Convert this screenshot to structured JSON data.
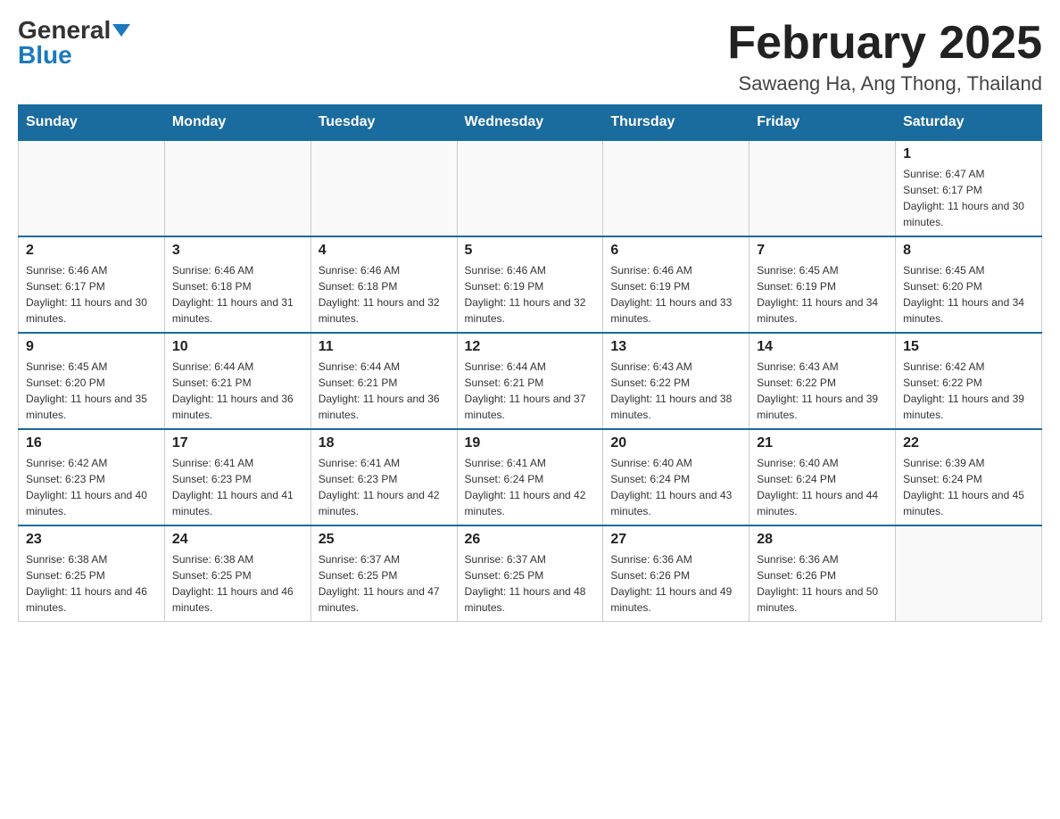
{
  "logo": {
    "general": "General",
    "blue": "Blue"
  },
  "title": {
    "month": "February 2025",
    "location": "Sawaeng Ha, Ang Thong, Thailand"
  },
  "days_of_week": [
    "Sunday",
    "Monday",
    "Tuesday",
    "Wednesday",
    "Thursday",
    "Friday",
    "Saturday"
  ],
  "weeks": [
    [
      {
        "day": "",
        "info": ""
      },
      {
        "day": "",
        "info": ""
      },
      {
        "day": "",
        "info": ""
      },
      {
        "day": "",
        "info": ""
      },
      {
        "day": "",
        "info": ""
      },
      {
        "day": "",
        "info": ""
      },
      {
        "day": "1",
        "info": "Sunrise: 6:47 AM\nSunset: 6:17 PM\nDaylight: 11 hours and 30 minutes."
      }
    ],
    [
      {
        "day": "2",
        "info": "Sunrise: 6:46 AM\nSunset: 6:17 PM\nDaylight: 11 hours and 30 minutes."
      },
      {
        "day": "3",
        "info": "Sunrise: 6:46 AM\nSunset: 6:18 PM\nDaylight: 11 hours and 31 minutes."
      },
      {
        "day": "4",
        "info": "Sunrise: 6:46 AM\nSunset: 6:18 PM\nDaylight: 11 hours and 32 minutes."
      },
      {
        "day": "5",
        "info": "Sunrise: 6:46 AM\nSunset: 6:19 PM\nDaylight: 11 hours and 32 minutes."
      },
      {
        "day": "6",
        "info": "Sunrise: 6:46 AM\nSunset: 6:19 PM\nDaylight: 11 hours and 33 minutes."
      },
      {
        "day": "7",
        "info": "Sunrise: 6:45 AM\nSunset: 6:19 PM\nDaylight: 11 hours and 34 minutes."
      },
      {
        "day": "8",
        "info": "Sunrise: 6:45 AM\nSunset: 6:20 PM\nDaylight: 11 hours and 34 minutes."
      }
    ],
    [
      {
        "day": "9",
        "info": "Sunrise: 6:45 AM\nSunset: 6:20 PM\nDaylight: 11 hours and 35 minutes."
      },
      {
        "day": "10",
        "info": "Sunrise: 6:44 AM\nSunset: 6:21 PM\nDaylight: 11 hours and 36 minutes."
      },
      {
        "day": "11",
        "info": "Sunrise: 6:44 AM\nSunset: 6:21 PM\nDaylight: 11 hours and 36 minutes."
      },
      {
        "day": "12",
        "info": "Sunrise: 6:44 AM\nSunset: 6:21 PM\nDaylight: 11 hours and 37 minutes."
      },
      {
        "day": "13",
        "info": "Sunrise: 6:43 AM\nSunset: 6:22 PM\nDaylight: 11 hours and 38 minutes."
      },
      {
        "day": "14",
        "info": "Sunrise: 6:43 AM\nSunset: 6:22 PM\nDaylight: 11 hours and 39 minutes."
      },
      {
        "day": "15",
        "info": "Sunrise: 6:42 AM\nSunset: 6:22 PM\nDaylight: 11 hours and 39 minutes."
      }
    ],
    [
      {
        "day": "16",
        "info": "Sunrise: 6:42 AM\nSunset: 6:23 PM\nDaylight: 11 hours and 40 minutes."
      },
      {
        "day": "17",
        "info": "Sunrise: 6:41 AM\nSunset: 6:23 PM\nDaylight: 11 hours and 41 minutes."
      },
      {
        "day": "18",
        "info": "Sunrise: 6:41 AM\nSunset: 6:23 PM\nDaylight: 11 hours and 42 minutes."
      },
      {
        "day": "19",
        "info": "Sunrise: 6:41 AM\nSunset: 6:24 PM\nDaylight: 11 hours and 42 minutes."
      },
      {
        "day": "20",
        "info": "Sunrise: 6:40 AM\nSunset: 6:24 PM\nDaylight: 11 hours and 43 minutes."
      },
      {
        "day": "21",
        "info": "Sunrise: 6:40 AM\nSunset: 6:24 PM\nDaylight: 11 hours and 44 minutes."
      },
      {
        "day": "22",
        "info": "Sunrise: 6:39 AM\nSunset: 6:24 PM\nDaylight: 11 hours and 45 minutes."
      }
    ],
    [
      {
        "day": "23",
        "info": "Sunrise: 6:38 AM\nSunset: 6:25 PM\nDaylight: 11 hours and 46 minutes."
      },
      {
        "day": "24",
        "info": "Sunrise: 6:38 AM\nSunset: 6:25 PM\nDaylight: 11 hours and 46 minutes."
      },
      {
        "day": "25",
        "info": "Sunrise: 6:37 AM\nSunset: 6:25 PM\nDaylight: 11 hours and 47 minutes."
      },
      {
        "day": "26",
        "info": "Sunrise: 6:37 AM\nSunset: 6:25 PM\nDaylight: 11 hours and 48 minutes."
      },
      {
        "day": "27",
        "info": "Sunrise: 6:36 AM\nSunset: 6:26 PM\nDaylight: 11 hours and 49 minutes."
      },
      {
        "day": "28",
        "info": "Sunrise: 6:36 AM\nSunset: 6:26 PM\nDaylight: 11 hours and 50 minutes."
      },
      {
        "day": "",
        "info": ""
      }
    ]
  ]
}
